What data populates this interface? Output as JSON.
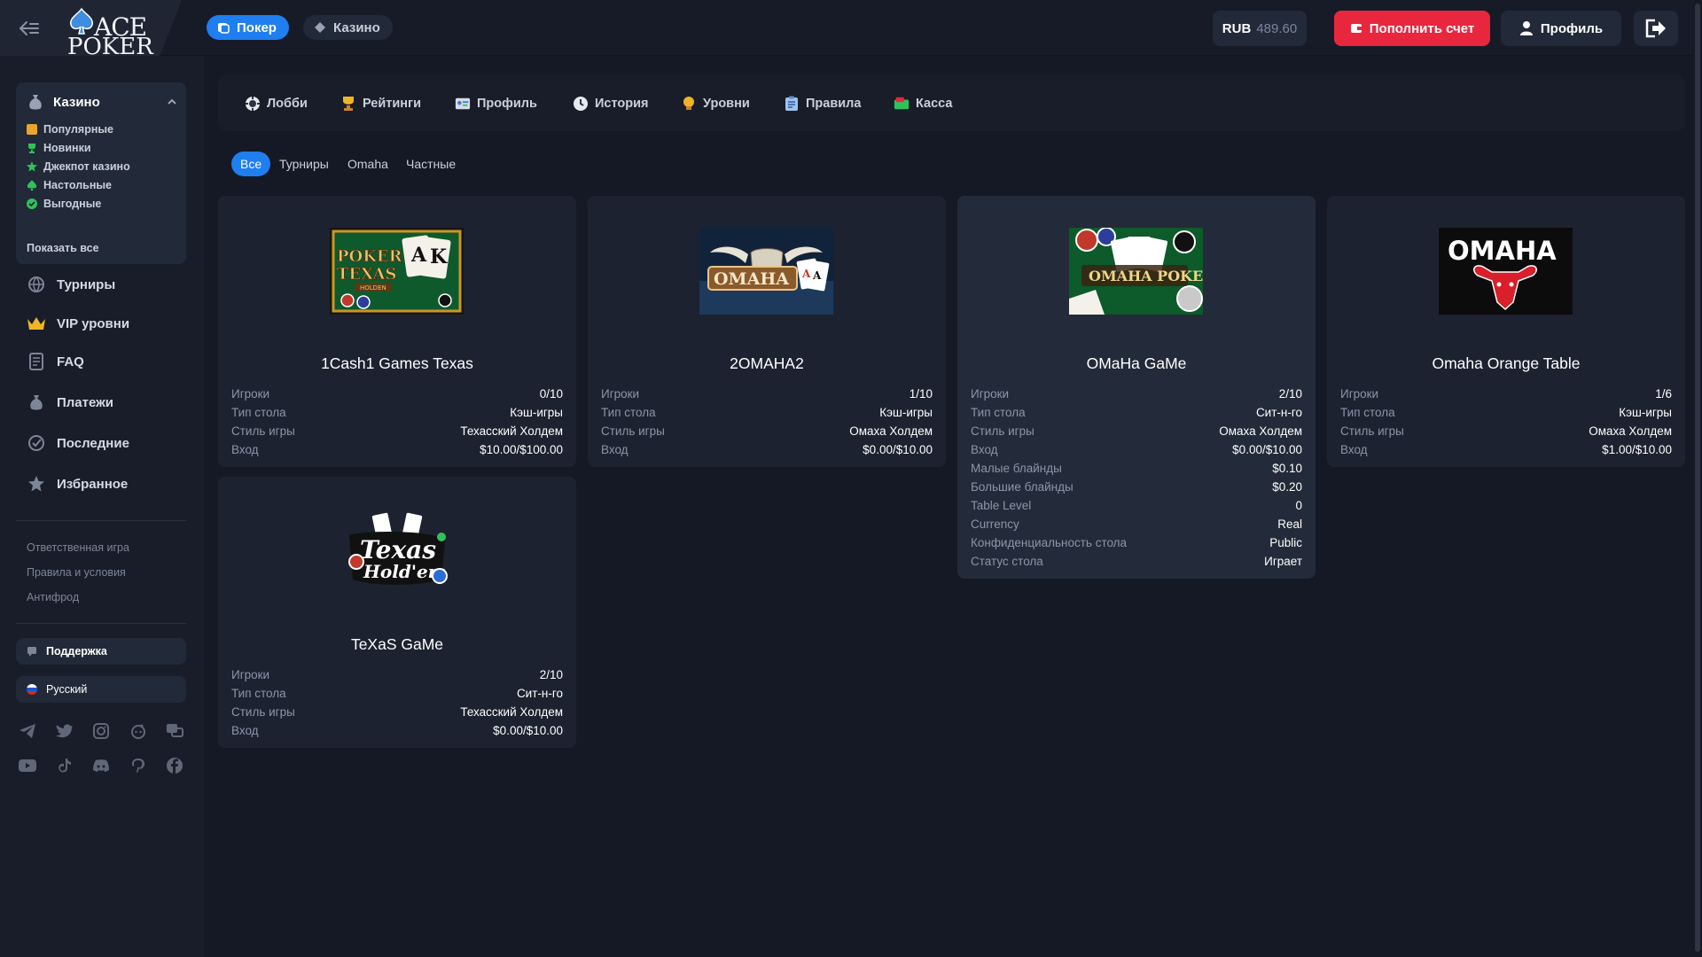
{
  "header": {
    "logo": {
      "line1": "ACE",
      "line2": "POKER"
    },
    "tabs": [
      {
        "label": "Покер",
        "active": true
      },
      {
        "label": "Казино",
        "active": false
      }
    ],
    "balance": {
      "currency": "RUB",
      "amount": "489.60"
    },
    "deposit_label": "Пополнить счет",
    "profile_label": "Профиль"
  },
  "sidebar": {
    "casino": {
      "label": "Казино",
      "items": [
        {
          "label": "Популярные",
          "color": "#e8a62a"
        },
        {
          "label": "Новинки",
          "color": "#2fc25b"
        },
        {
          "label": "Джекпот казино",
          "color": "#2fc25b"
        },
        {
          "label": "Настольные",
          "color": "#2fc25b"
        },
        {
          "label": "Выгодные",
          "color": "#2fc25b"
        }
      ],
      "show_all": "Показать все"
    },
    "nav": [
      {
        "label": "Турниры",
        "icon": "globe-icon"
      },
      {
        "label": "VIP уровни",
        "icon": "crown-icon"
      },
      {
        "label": "FAQ",
        "icon": "document-icon"
      },
      {
        "label": "Платежи",
        "icon": "moneybag-icon"
      },
      {
        "label": "Последние",
        "icon": "check-circle-icon"
      },
      {
        "label": "Избранное",
        "icon": "star-icon"
      }
    ],
    "links": [
      "Ответственная игра",
      "Правила и условия",
      "Антифрод"
    ],
    "support_label": "Поддержка",
    "language_label": "Русский",
    "socials_row1": [
      "telegram-icon",
      "twitter-icon",
      "instagram-icon",
      "reddit-icon",
      "forum-icon"
    ],
    "socials_row2": [
      "youtube-icon",
      "tiktok-icon",
      "discord-icon",
      "pinterest-icon",
      "facebook-icon"
    ]
  },
  "main_nav": [
    {
      "label": "Лобби",
      "icon": "lobby-icon"
    },
    {
      "label": "Рейтинги",
      "icon": "trophy-icon"
    },
    {
      "label": "Профиль",
      "icon": "id-card-icon"
    },
    {
      "label": "История",
      "icon": "clock-icon"
    },
    {
      "label": "Уровни",
      "icon": "bulb-icon"
    },
    {
      "label": "Правила",
      "icon": "clipboard-icon"
    },
    {
      "label": "Касса",
      "icon": "cashier-icon"
    }
  ],
  "filters": [
    {
      "label": "Все",
      "active": true
    },
    {
      "label": "Турниры",
      "active": false
    },
    {
      "label": "Omaha",
      "active": false
    },
    {
      "label": "Частные",
      "active": false
    }
  ],
  "tables": [
    {
      "title": "1Cash1 Games Texas",
      "image_text": "POKER TEXAS HOLDEN",
      "rows": [
        {
          "k": "Игроки",
          "v": "0/10"
        },
        {
          "k": "Тип стола",
          "v": "Кэш-игры"
        },
        {
          "k": "Стиль игры",
          "v": "Техасский Холдем"
        },
        {
          "k": "Вход",
          "v": "$10.00/$100.00"
        }
      ]
    },
    {
      "title": "2OMAHA2",
      "image_text": "OMAHA",
      "rows": [
        {
          "k": "Игроки",
          "v": "1/10"
        },
        {
          "k": "Тип стола",
          "v": "Кэш-игры"
        },
        {
          "k": "Стиль игры",
          "v": "Омаха Холдем"
        },
        {
          "k": "Вход",
          "v": "$0.00/$10.00"
        }
      ]
    },
    {
      "title": "OMaHa GaMe",
      "image_text": "OMAHA POKER",
      "rows": [
        {
          "k": "Игроки",
          "v": "2/10"
        },
        {
          "k": "Тип стола",
          "v": "Сит-н-го"
        },
        {
          "k": "Стиль игры",
          "v": "Омаха Холдем"
        },
        {
          "k": "Вход",
          "v": "$0.00/$10.00"
        },
        {
          "k": "Малые блайнды",
          "v": "$0.10"
        },
        {
          "k": "Большие блайнды",
          "v": "$0.20"
        },
        {
          "k": "Table Level",
          "v": "0"
        },
        {
          "k": "Currency",
          "v": "Real"
        },
        {
          "k": "Конфиденциальность стола",
          "v": "Public"
        },
        {
          "k": "Статус стола",
          "v": "Играет"
        }
      ]
    },
    {
      "title": "Omaha Orange Table",
      "image_text": "OMAHA",
      "rows": [
        {
          "k": "Игроки",
          "v": "1/6"
        },
        {
          "k": "Тип стола",
          "v": "Кэш-игры"
        },
        {
          "k": "Стиль игры",
          "v": "Омаха Холдем"
        },
        {
          "k": "Вход",
          "v": "$1.00/$10.00"
        }
      ]
    },
    {
      "title": "TeXaS GaMe",
      "image_text": "Texas Hold'em",
      "rows": [
        {
          "k": "Игроки",
          "v": "2/10"
        },
        {
          "k": "Тип стола",
          "v": "Сит-н-го"
        },
        {
          "k": "Стиль игры",
          "v": "Техасский Холдем"
        },
        {
          "k": "Вход",
          "v": "$0.00/$10.00"
        }
      ]
    }
  ]
}
